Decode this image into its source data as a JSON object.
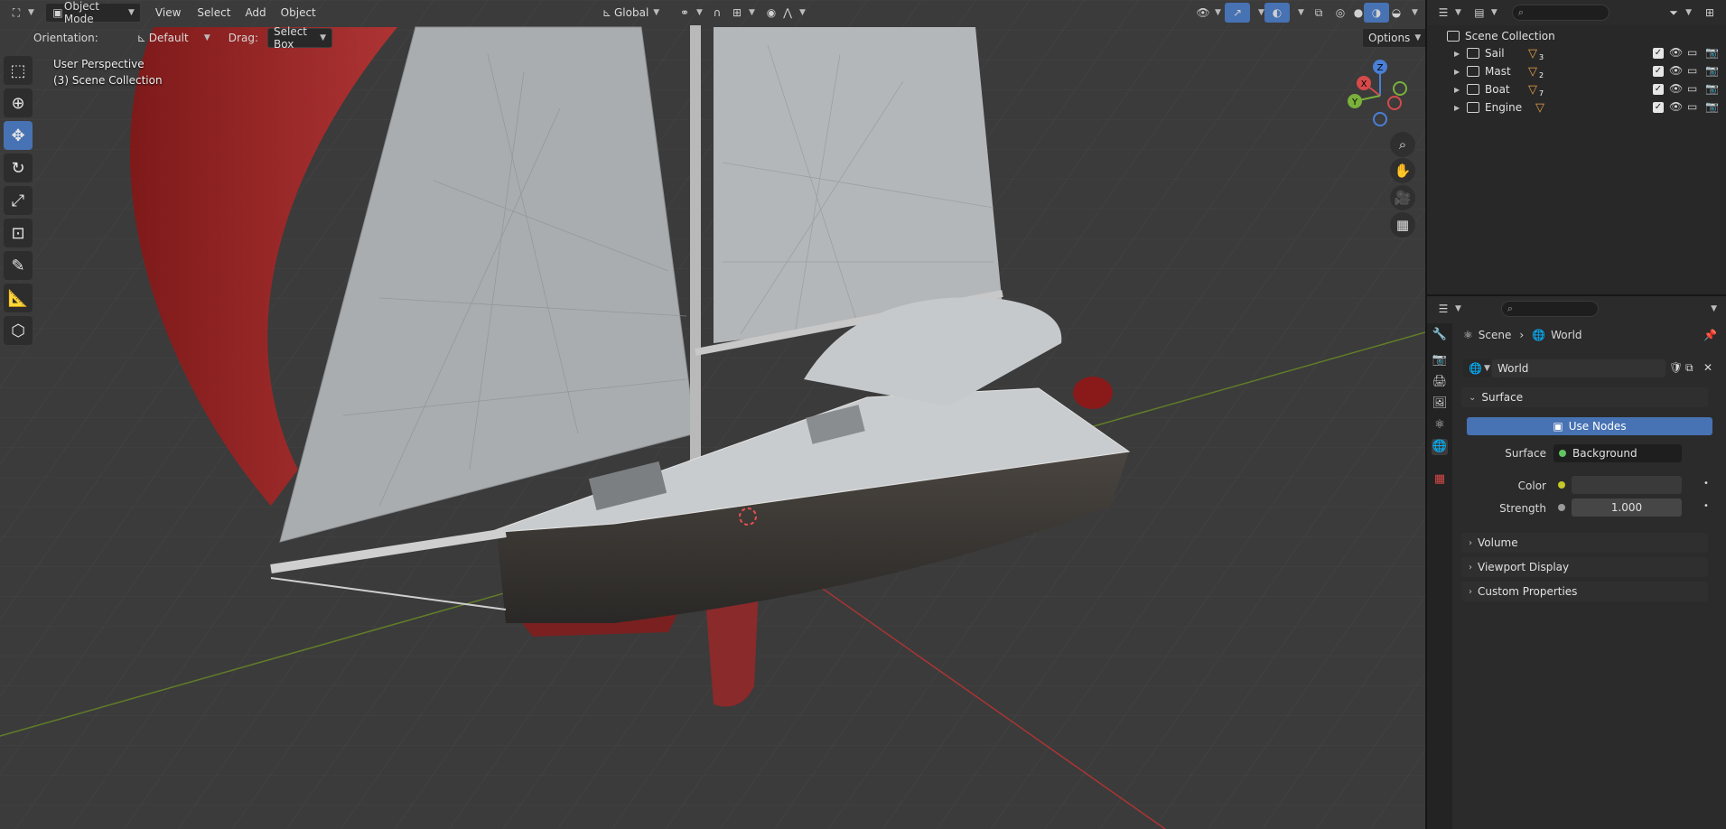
{
  "header": {
    "mode": "Object Mode",
    "menus": [
      "View",
      "Select",
      "Add",
      "Object"
    ],
    "transform_orientation": "Global",
    "options_label": "Options"
  },
  "toolbar": {
    "orientation_label": "Orientation:",
    "orientation_value": "Default",
    "drag_label": "Drag:",
    "drag_value": "Select Box"
  },
  "viewport": {
    "perspective": "User Perspective",
    "collection": "(3) Scene Collection"
  },
  "gizmo": {
    "x": "X",
    "y": "Y",
    "z": "Z"
  },
  "outliner": {
    "root": "Scene Collection",
    "items": [
      {
        "label": "Sail",
        "count": "3"
      },
      {
        "label": "Mast",
        "count": "2"
      },
      {
        "label": "Boat",
        "count": "7"
      },
      {
        "label": "Engine",
        "count": ""
      }
    ]
  },
  "properties": {
    "breadcrumb_scene": "Scene",
    "breadcrumb_world": "World",
    "world_name": "World",
    "surface_panel": "Surface",
    "use_nodes": "Use Nodes",
    "surface_label": "Surface",
    "surface_value": "Background",
    "color_label": "Color",
    "strength_label": "Strength",
    "strength_value": "1.000",
    "panels": [
      "Volume",
      "Viewport Display",
      "Custom Properties"
    ]
  }
}
